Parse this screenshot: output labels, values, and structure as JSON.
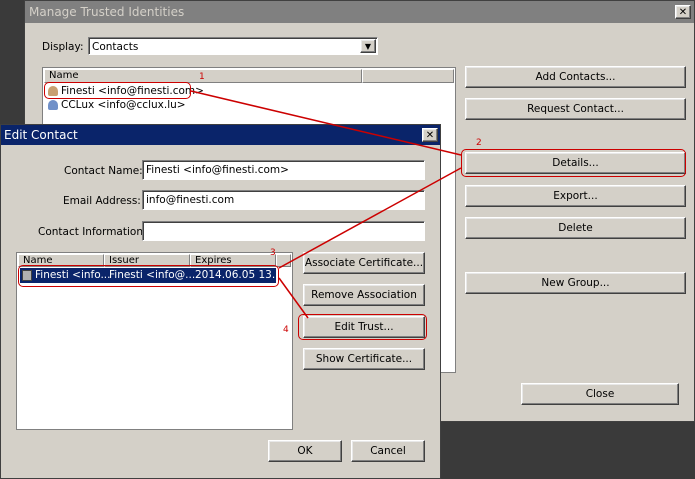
{
  "main_window": {
    "title": "Manage Trusted Identities",
    "display_label": "Display:",
    "display_value": "Contacts",
    "list_header": "Name",
    "contacts": [
      "Finesti <info@finesti.com>",
      "CCLux <info@cclux.lu>"
    ],
    "buttons": {
      "add_contacts": "Add Contacts...",
      "request_contact": "Request Contact...",
      "details": "Details...",
      "export": "Export...",
      "delete": "Delete",
      "new_group": "New Group...",
      "close": "Close"
    }
  },
  "edit_contact": {
    "title": "Edit Contact",
    "contact_name_label": "Contact Name:",
    "contact_name_value": "Finesti <info@finesti.com>",
    "email_label": "Email Address:",
    "email_value": "info@finesti.com",
    "contact_info_label": "Contact Information:",
    "contact_info_value": "",
    "cert_columns": [
      "Name",
      "Issuer",
      "Expires"
    ],
    "cert_row": {
      "name": "Finesti <info...",
      "issuer": "Finesti <info@...",
      "expires": "2014.06.05 13..."
    },
    "buttons": {
      "associate_certificate": "Associate Certificate...",
      "remove_association": "Remove Association",
      "edit_trust": "Edit Trust...",
      "show_certificate": "Show Certificate...",
      "ok": "OK",
      "cancel": "Cancel"
    }
  },
  "annotations": [
    "1",
    "2",
    "3",
    "4"
  ],
  "colors": {
    "highlight": "#cc0000",
    "title_bar_inactive": "#808080",
    "title_bar_active": "#0a246a",
    "selection": "#0a246a"
  }
}
